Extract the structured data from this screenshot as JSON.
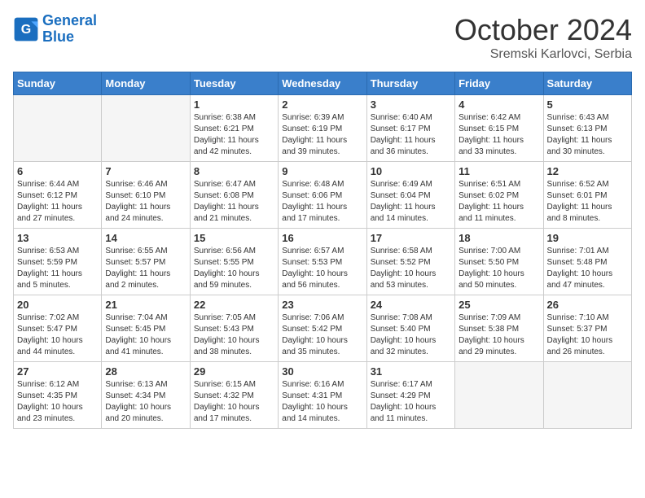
{
  "header": {
    "logo_line1": "General",
    "logo_line2": "Blue",
    "month": "October 2024",
    "location": "Sremski Karlovci, Serbia"
  },
  "weekdays": [
    "Sunday",
    "Monday",
    "Tuesday",
    "Wednesday",
    "Thursday",
    "Friday",
    "Saturday"
  ],
  "weeks": [
    [
      {
        "day": "",
        "detail": ""
      },
      {
        "day": "",
        "detail": ""
      },
      {
        "day": "1",
        "detail": "Sunrise: 6:38 AM\nSunset: 6:21 PM\nDaylight: 11 hours\nand 42 minutes."
      },
      {
        "day": "2",
        "detail": "Sunrise: 6:39 AM\nSunset: 6:19 PM\nDaylight: 11 hours\nand 39 minutes."
      },
      {
        "day": "3",
        "detail": "Sunrise: 6:40 AM\nSunset: 6:17 PM\nDaylight: 11 hours\nand 36 minutes."
      },
      {
        "day": "4",
        "detail": "Sunrise: 6:42 AM\nSunset: 6:15 PM\nDaylight: 11 hours\nand 33 minutes."
      },
      {
        "day": "5",
        "detail": "Sunrise: 6:43 AM\nSunset: 6:13 PM\nDaylight: 11 hours\nand 30 minutes."
      }
    ],
    [
      {
        "day": "6",
        "detail": "Sunrise: 6:44 AM\nSunset: 6:12 PM\nDaylight: 11 hours\nand 27 minutes."
      },
      {
        "day": "7",
        "detail": "Sunrise: 6:46 AM\nSunset: 6:10 PM\nDaylight: 11 hours\nand 24 minutes."
      },
      {
        "day": "8",
        "detail": "Sunrise: 6:47 AM\nSunset: 6:08 PM\nDaylight: 11 hours\nand 21 minutes."
      },
      {
        "day": "9",
        "detail": "Sunrise: 6:48 AM\nSunset: 6:06 PM\nDaylight: 11 hours\nand 17 minutes."
      },
      {
        "day": "10",
        "detail": "Sunrise: 6:49 AM\nSunset: 6:04 PM\nDaylight: 11 hours\nand 14 minutes."
      },
      {
        "day": "11",
        "detail": "Sunrise: 6:51 AM\nSunset: 6:02 PM\nDaylight: 11 hours\nand 11 minutes."
      },
      {
        "day": "12",
        "detail": "Sunrise: 6:52 AM\nSunset: 6:01 PM\nDaylight: 11 hours\nand 8 minutes."
      }
    ],
    [
      {
        "day": "13",
        "detail": "Sunrise: 6:53 AM\nSunset: 5:59 PM\nDaylight: 11 hours\nand 5 minutes."
      },
      {
        "day": "14",
        "detail": "Sunrise: 6:55 AM\nSunset: 5:57 PM\nDaylight: 11 hours\nand 2 minutes."
      },
      {
        "day": "15",
        "detail": "Sunrise: 6:56 AM\nSunset: 5:55 PM\nDaylight: 10 hours\nand 59 minutes."
      },
      {
        "day": "16",
        "detail": "Sunrise: 6:57 AM\nSunset: 5:53 PM\nDaylight: 10 hours\nand 56 minutes."
      },
      {
        "day": "17",
        "detail": "Sunrise: 6:58 AM\nSunset: 5:52 PM\nDaylight: 10 hours\nand 53 minutes."
      },
      {
        "day": "18",
        "detail": "Sunrise: 7:00 AM\nSunset: 5:50 PM\nDaylight: 10 hours\nand 50 minutes."
      },
      {
        "day": "19",
        "detail": "Sunrise: 7:01 AM\nSunset: 5:48 PM\nDaylight: 10 hours\nand 47 minutes."
      }
    ],
    [
      {
        "day": "20",
        "detail": "Sunrise: 7:02 AM\nSunset: 5:47 PM\nDaylight: 10 hours\nand 44 minutes."
      },
      {
        "day": "21",
        "detail": "Sunrise: 7:04 AM\nSunset: 5:45 PM\nDaylight: 10 hours\nand 41 minutes."
      },
      {
        "day": "22",
        "detail": "Sunrise: 7:05 AM\nSunset: 5:43 PM\nDaylight: 10 hours\nand 38 minutes."
      },
      {
        "day": "23",
        "detail": "Sunrise: 7:06 AM\nSunset: 5:42 PM\nDaylight: 10 hours\nand 35 minutes."
      },
      {
        "day": "24",
        "detail": "Sunrise: 7:08 AM\nSunset: 5:40 PM\nDaylight: 10 hours\nand 32 minutes."
      },
      {
        "day": "25",
        "detail": "Sunrise: 7:09 AM\nSunset: 5:38 PM\nDaylight: 10 hours\nand 29 minutes."
      },
      {
        "day": "26",
        "detail": "Sunrise: 7:10 AM\nSunset: 5:37 PM\nDaylight: 10 hours\nand 26 minutes."
      }
    ],
    [
      {
        "day": "27",
        "detail": "Sunrise: 6:12 AM\nSunset: 4:35 PM\nDaylight: 10 hours\nand 23 minutes."
      },
      {
        "day": "28",
        "detail": "Sunrise: 6:13 AM\nSunset: 4:34 PM\nDaylight: 10 hours\nand 20 minutes."
      },
      {
        "day": "29",
        "detail": "Sunrise: 6:15 AM\nSunset: 4:32 PM\nDaylight: 10 hours\nand 17 minutes."
      },
      {
        "day": "30",
        "detail": "Sunrise: 6:16 AM\nSunset: 4:31 PM\nDaylight: 10 hours\nand 14 minutes."
      },
      {
        "day": "31",
        "detail": "Sunrise: 6:17 AM\nSunset: 4:29 PM\nDaylight: 10 hours\nand 11 minutes."
      },
      {
        "day": "",
        "detail": ""
      },
      {
        "day": "",
        "detail": ""
      }
    ]
  ]
}
